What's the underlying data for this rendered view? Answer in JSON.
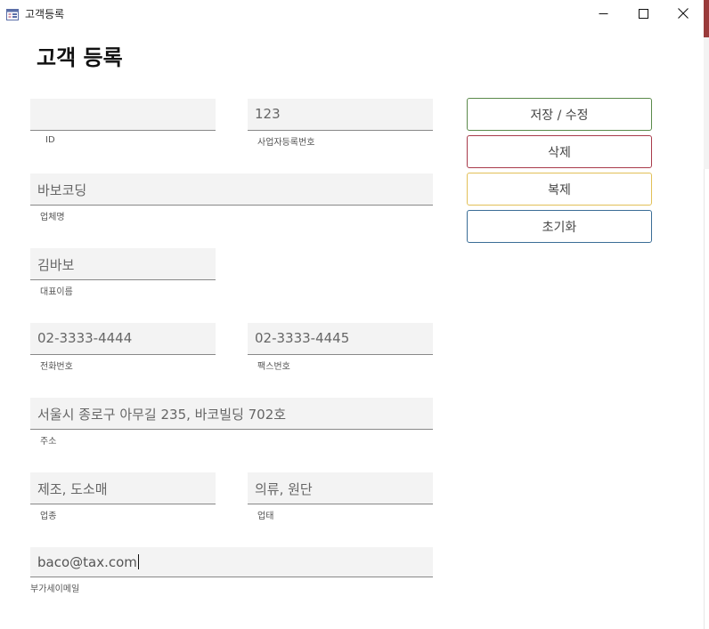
{
  "window": {
    "title": "고객등록",
    "controls": [
      "minimize",
      "maximize",
      "close"
    ]
  },
  "page": {
    "title": "고객 등록"
  },
  "form": {
    "id": {
      "value": "",
      "label": "ID"
    },
    "business_number": {
      "value": "123",
      "label": "사업자등록번호"
    },
    "company_name": {
      "value": "바보코딩",
      "label": "업체명"
    },
    "representative": {
      "value": "김바보",
      "label": "대표이름"
    },
    "phone": {
      "value": "02-3333-4444",
      "label": "전화번호"
    },
    "fax": {
      "value": "02-3333-4445",
      "label": "팩스번호"
    },
    "address": {
      "value": "서울시 종로구 아무길 235, 바코빌딩 702호",
      "label": "주소"
    },
    "industry": {
      "value": "제조, 도소매",
      "label": "업종"
    },
    "business_type": {
      "value": "의류, 원단",
      "label": "업태"
    },
    "tax_email": {
      "value": "baco@tax.com",
      "label": "부가세이메일"
    }
  },
  "actions": {
    "save": "저장 / 수정",
    "delete": "삭제",
    "duplicate": "복제",
    "reset": "초기화"
  },
  "colors": {
    "save_border": "#5a8a4a",
    "delete_border": "#a83a4a",
    "duplicate_border": "#e2c057",
    "reset_border": "#3a6d96",
    "field_bg": "#f3f3f3"
  },
  "icons": {
    "app": "form-window-icon",
    "minimize": "minimize-icon",
    "maximize": "maximize-icon",
    "close": "close-icon"
  }
}
